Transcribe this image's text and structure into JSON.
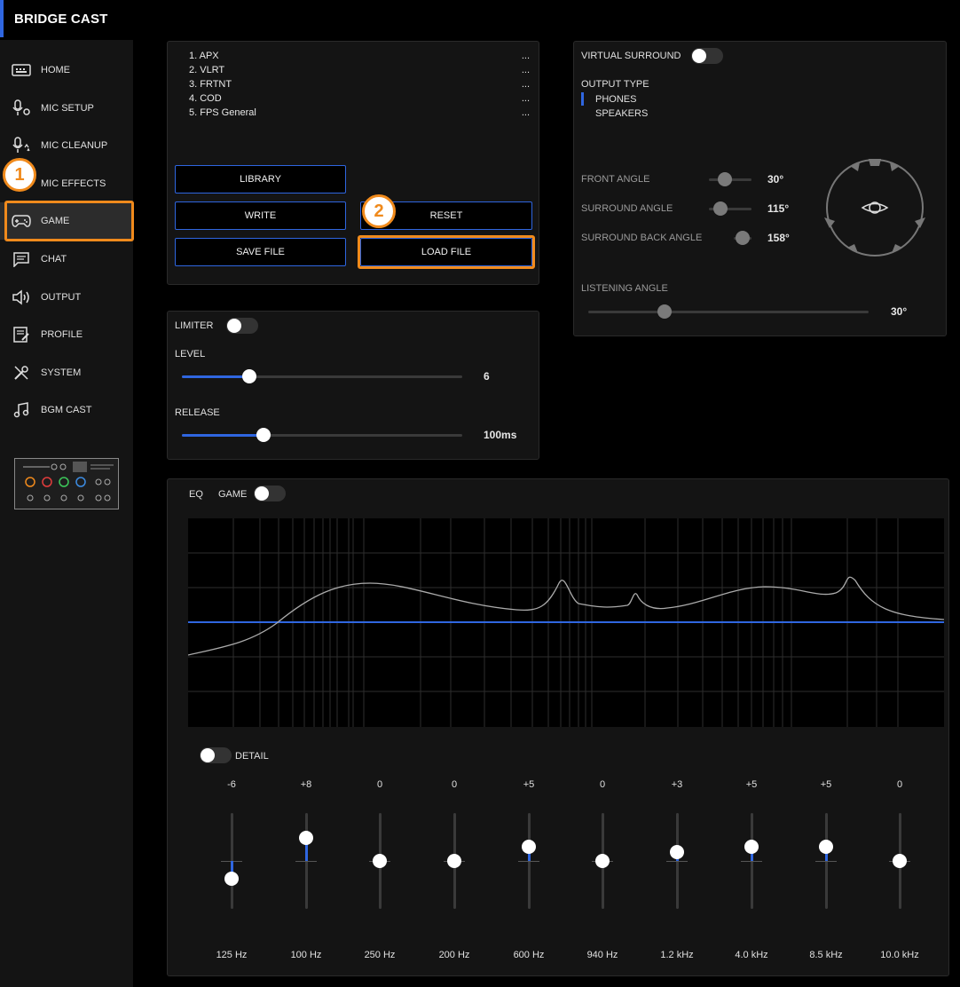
{
  "app": {
    "title": "BRIDGE CAST"
  },
  "sidebar": {
    "items": [
      {
        "label": "HOME",
        "icon": "keyboard-icon"
      },
      {
        "label": "MIC SETUP",
        "icon": "mic-settings-icon"
      },
      {
        "label": "MIC CLEANUP",
        "icon": "mic-cleanup-icon"
      },
      {
        "label": "MIC EFFECTS",
        "icon": "mic-effects-icon"
      },
      {
        "label": "GAME",
        "icon": "gamepad-icon",
        "active": true
      },
      {
        "label": "CHAT",
        "icon": "chat-icon"
      },
      {
        "label": "OUTPUT",
        "icon": "speaker-icon"
      },
      {
        "label": "PROFILE",
        "icon": "profile-icon"
      },
      {
        "label": "SYSTEM",
        "icon": "tools-icon"
      },
      {
        "label": "BGM CAST",
        "icon": "music-icon"
      }
    ]
  },
  "callouts": {
    "one": "1",
    "two": "2"
  },
  "presets": {
    "items": [
      {
        "label": "1. APX",
        "more": "..."
      },
      {
        "label": "2. VLRT",
        "more": "..."
      },
      {
        "label": "3. FRTNT",
        "more": "..."
      },
      {
        "label": "4. COD",
        "more": "..."
      },
      {
        "label": "5. FPS General",
        "more": "..."
      }
    ],
    "buttons": {
      "library": "LIBRARY",
      "write": "WRITE",
      "reset": "RESET",
      "save_file": "SAVE FILE",
      "load_file": "LOAD FILE"
    }
  },
  "limiter": {
    "label": "LIMITER",
    "enabled": false,
    "level_label": "LEVEL",
    "level_value": "6",
    "level_fraction": 0.24,
    "release_label": "RELEASE",
    "release_value": "100ms",
    "release_fraction": 0.29
  },
  "surround": {
    "label": "VIRTUAL SURROUND",
    "enabled": false,
    "output_type_label": "OUTPUT TYPE",
    "output_types": [
      "PHONES",
      "SPEAKERS"
    ],
    "selected_output": "PHONES",
    "front_angle_label": "FRONT ANGLE",
    "front_angle_value": "30°",
    "surround_angle_label": "SURROUND ANGLE",
    "surround_angle_value": "115°",
    "surround_back_angle_label": "SURROUND BACK ANGLE",
    "surround_back_angle_value": "158°",
    "listening_angle_label": "LISTENING ANGLE",
    "listening_angle_value": "30°"
  },
  "eq": {
    "label": "EQ",
    "channel": "GAME",
    "enabled": false,
    "detail_label": "DETAIL",
    "detail_enabled": false,
    "bands": [
      {
        "value": "-6",
        "freq": "125 Hz",
        "gain": -6
      },
      {
        "value": "+8",
        "freq": "100 Hz",
        "gain": 8
      },
      {
        "value": "0",
        "freq": "250 Hz",
        "gain": 0
      },
      {
        "value": "0",
        "freq": "200 Hz",
        "gain": 0
      },
      {
        "value": "+5",
        "freq": "600 Hz",
        "gain": 5
      },
      {
        "value": "0",
        "freq": "940 Hz",
        "gain": 0
      },
      {
        "value": "+3",
        "freq": "1.2 kHz",
        "gain": 3
      },
      {
        "value": "+5",
        "freq": "4.0 kHz",
        "gain": 5
      },
      {
        "value": "+5",
        "freq": "8.5 kHz",
        "gain": 5
      },
      {
        "value": "0",
        "freq": "10.0 kHz",
        "gain": 0
      }
    ]
  },
  "colors": {
    "accent": "#2f66e0",
    "highlight": "#f08a1c"
  }
}
